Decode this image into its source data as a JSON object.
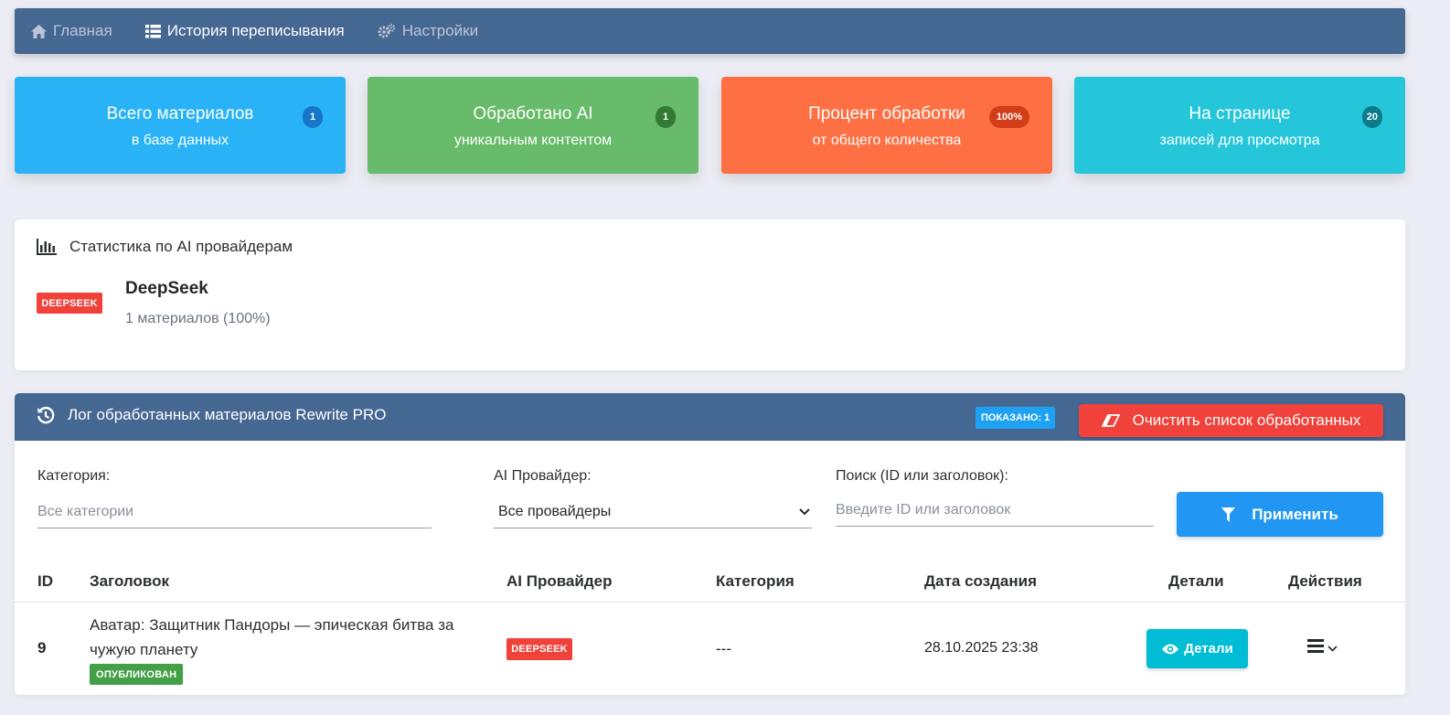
{
  "nav": {
    "home": "Главная",
    "history": "История переписывания",
    "settings": "Настройки"
  },
  "cards": [
    {
      "title": "Всего материалов",
      "subtitle": "в базе данных",
      "badge": "1"
    },
    {
      "title": "Обработано AI",
      "subtitle": "уникальным контентом",
      "badge": "1"
    },
    {
      "title": "Процент обработки",
      "subtitle": "от общего количества",
      "badge": "100%"
    },
    {
      "title": "На странице",
      "subtitle": "записей для просмотра",
      "badge": "20"
    }
  ],
  "providers_panel": {
    "title": "Статистика по AI провайдерам",
    "provider_tag": "DEEPSEEK",
    "provider_name": "DeepSeek",
    "provider_count": "1 материалов (100%)"
  },
  "log": {
    "title": "Лог обработанных материалов Rewrite PRO",
    "shown_badge": "ПОКАЗАНО: 1",
    "clear_label": "Очистить список обработанных",
    "filters": {
      "category_label": "Категория:",
      "category_placeholder": "Все категории",
      "provider_label": "AI Провайдер:",
      "provider_value": "Все провайдеры",
      "search_label": "Поиск (ID или заголовок):",
      "search_placeholder": "Введите ID или заголовок",
      "apply_label": "Применить"
    },
    "columns": [
      "ID",
      "Заголовок",
      "AI Провайдер",
      "Категория",
      "Дата создания",
      "Детали",
      "Действия"
    ],
    "rows": [
      {
        "id": "9",
        "title": "Аватар: Защитник Пандоры — эпическая битва за чужую планету",
        "status": "ОПУБЛИКОВАН",
        "provider": "DEEPSEEK",
        "category": "---",
        "date": "28.10.2025 23:38",
        "details_label": "Детали"
      }
    ]
  },
  "colors": {
    "nav_bg": "#456892",
    "card_blue": "#29b3f6",
    "card_green": "#67bb6a",
    "card_orange": "#fe7043",
    "card_teal": "#26c6da",
    "danger": "#f0413a",
    "primary": "#2196f2",
    "info": "#00bcd4",
    "success": "#43a047"
  }
}
